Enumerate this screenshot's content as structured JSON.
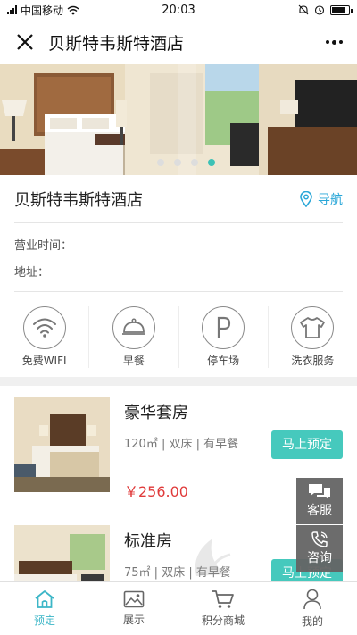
{
  "status_bar": {
    "carrier": "中国移动",
    "time": "20:03"
  },
  "header": {
    "title": "贝斯特韦斯特酒店"
  },
  "banner": {
    "slide_count": 4,
    "active_index": 3
  },
  "hotel": {
    "name": "贝斯特韦斯特酒店",
    "nav_label": "导航",
    "hours_label": "营业时间：",
    "address_label": "地址："
  },
  "amenities": [
    {
      "label": "免费WIFI",
      "icon": "wifi-icon"
    },
    {
      "label": "早餐",
      "icon": "breakfast-icon"
    },
    {
      "label": "停车场",
      "icon": "parking-icon"
    },
    {
      "label": "洗衣服务",
      "icon": "laundry-icon"
    }
  ],
  "rooms": [
    {
      "name": "豪华套房",
      "area": "120㎡",
      "bed": "双床",
      "breakfast": "有早餐",
      "price": "￥256.00",
      "book_label": "马上预定"
    },
    {
      "name": "标准房",
      "area": "75㎡",
      "bed": "双床",
      "breakfast": "有早餐",
      "price": "",
      "book_label": "马上预定"
    }
  ],
  "floating": {
    "service_label": "客服",
    "consult_label": "咨询"
  },
  "tabs": [
    {
      "label": "预定",
      "icon": "home-icon",
      "active": true
    },
    {
      "label": "展示",
      "icon": "image-icon",
      "active": false
    },
    {
      "label": "积分商城",
      "icon": "cart-icon",
      "active": false
    },
    {
      "label": "我的",
      "icon": "user-icon",
      "active": false
    }
  ],
  "colors": {
    "accent": "#46c9bd",
    "price": "#e03a3a",
    "link": "#2aa7d8",
    "tab_active": "#3cb6c7"
  }
}
